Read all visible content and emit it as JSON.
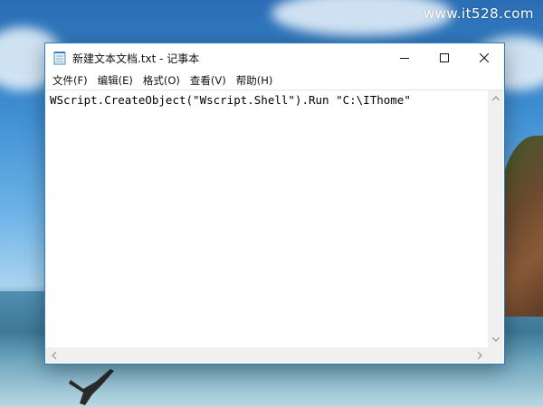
{
  "watermark": "www.it528.com",
  "window": {
    "title": "新建文本文档.txt - 记事本",
    "menu": [
      "文件(F)",
      "编辑(E)",
      "格式(O)",
      "查看(V)",
      "帮助(H)"
    ],
    "content": "WScript.CreateObject(\"Wscript.Shell\").Run \"C:\\IThome\""
  },
  "colors": {
    "window_border": "#2f7fc4",
    "scrollbar": "#f0f0f0"
  }
}
